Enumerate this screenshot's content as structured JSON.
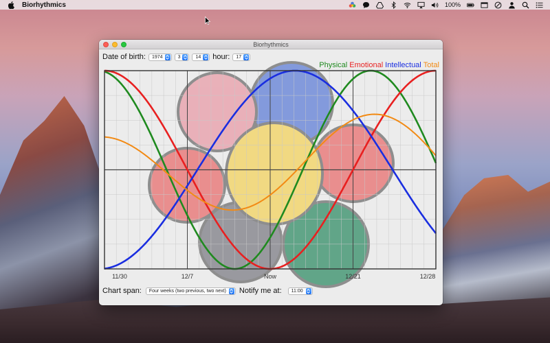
{
  "menubar": {
    "app_name": "Biorhythmics",
    "battery_percent": "100%"
  },
  "window": {
    "title": "Biorhythmics",
    "dob_label": "Date of birth:",
    "dob_year": "1974",
    "dob_month": "3",
    "dob_day": "14",
    "hour_label": "hour:",
    "hour_value": "17",
    "span_label": "Chart span:",
    "span_value": "Four weeks (two previous, two next)",
    "notify_label": "Notify me at:",
    "notify_value": "11:00"
  },
  "colors": {
    "physical": "#1f8a1f",
    "emotional": "#e82020",
    "intellectual": "#1a2ee0",
    "total": "#f28a14"
  },
  "chart_data": {
    "type": "line",
    "x_ticks": [
      "11/30",
      "12/7",
      "Now",
      "12/21",
      "12/28"
    ],
    "x": [
      -14,
      14
    ],
    "ylim": [
      -1,
      1
    ],
    "grid": true,
    "legend": "top-right",
    "series": [
      {
        "name": "Physical",
        "period_days": 23,
        "peak_day": 8.5
      },
      {
        "name": "Emotional",
        "period_days": 28,
        "peak_day": 14
      },
      {
        "name": "Intellectual",
        "period_days": 33,
        "peak_day": 2.1
      },
      {
        "name": "Total"
      }
    ]
  }
}
